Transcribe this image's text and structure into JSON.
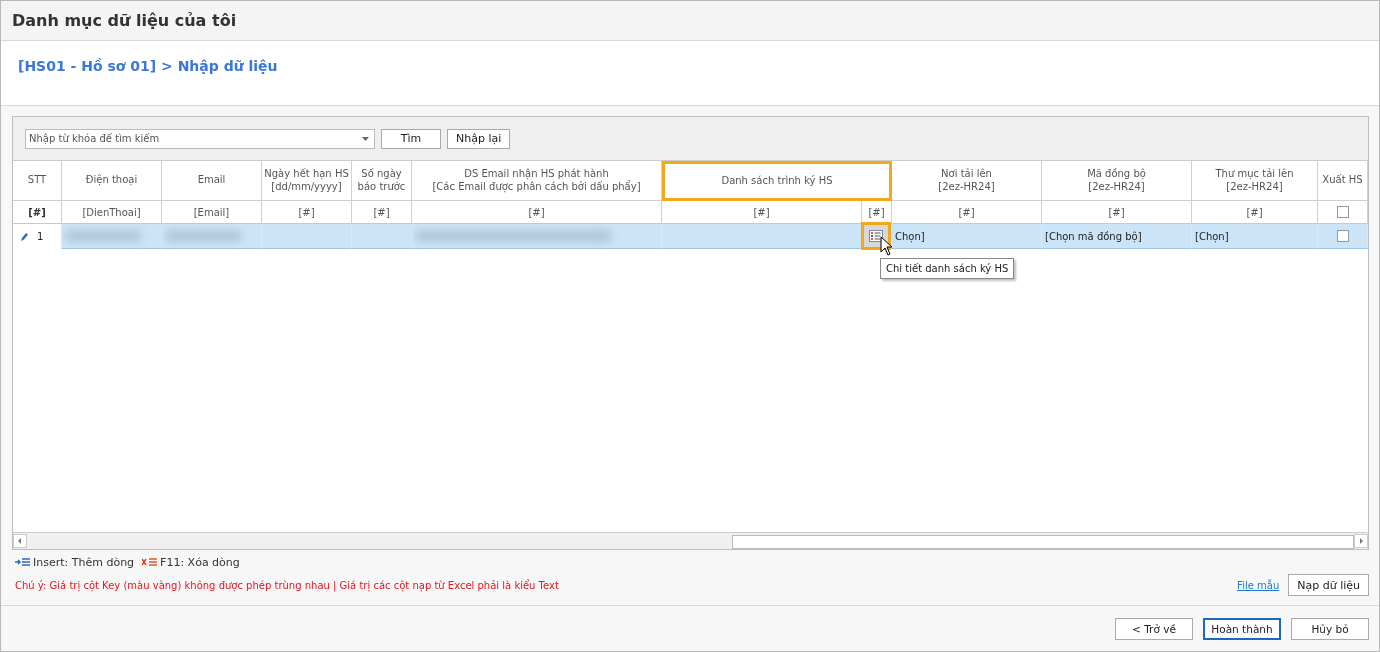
{
  "window": {
    "title": "Danh mục dữ liệu của tôi"
  },
  "breadcrumb": "[HS01 - Hồ sơ 01] > Nhập dữ liệu",
  "search": {
    "placeholder": "Nhập từ khóa để tìm kiếm"
  },
  "toolbar_buttons": [
    "Tìm",
    "Nhập lại"
  ],
  "columns": [
    {
      "header": "STT",
      "filters": [
        {
          "kind": "text",
          "text": "[#]"
        }
      ],
      "highlighted": false
    },
    {
      "header": "Điện thoại",
      "filters": [
        {
          "kind": "text",
          "text": "[DienThoai]"
        }
      ],
      "highlighted": false
    },
    {
      "header": "Email",
      "filters": [
        {
          "kind": "text",
          "text": "[Email]"
        }
      ],
      "highlighted": false
    },
    {
      "header": "Ngày hết hạn HS\n[dd/mm/yyyy]",
      "filters": [
        {
          "kind": "text",
          "text": "[#]"
        }
      ],
      "highlighted": false
    },
    {
      "header": "Số ngày\nbáo trước",
      "filters": [
        {
          "kind": "text",
          "text": "[#]"
        }
      ],
      "highlighted": false
    },
    {
      "header": "DS Email nhận HS phát hành\n[Các Email được phân cách bởi dấu phẩy]",
      "filters": [
        {
          "kind": "text",
          "text": "[#]"
        }
      ],
      "highlighted": false
    },
    {
      "header": "Danh sách trình ký HS",
      "filters": [
        {
          "kind": "text",
          "text": "[#]"
        },
        {
          "kind": "text",
          "text": "[#]"
        }
      ],
      "highlighted": true
    },
    {
      "header": "Nơi tải lên\n[2ez-HR24]",
      "filters": [
        {
          "kind": "text",
          "text": "[#]"
        }
      ],
      "highlighted": false
    },
    {
      "header": "Mã đồng bộ\n[2ez-HR24]",
      "filters": [
        {
          "kind": "text",
          "text": "[#]"
        }
      ],
      "highlighted": false
    },
    {
      "header": "Thư mục tải lên\n[2ez-HR24]",
      "filters": [
        {
          "kind": "text",
          "text": "[#]"
        }
      ],
      "highlighted": false
    },
    {
      "header": "Xuất HS",
      "filters": [
        {
          "kind": "checkbox",
          "checked": false
        }
      ],
      "highlighted": false
    }
  ],
  "rows": [
    {
      "selected": true,
      "editing": true,
      "number": "1",
      "cells": [
        {
          "kind": "blurred"
        },
        {
          "kind": "blurred"
        },
        {
          "kind": "empty"
        },
        {
          "kind": "empty"
        },
        {
          "kind": "blurred"
        },
        {
          "kind": "empty"
        },
        {
          "kind": "list-button",
          "highlighted": true
        },
        {
          "kind": "text",
          "text": "Chọn]"
        },
        {
          "kind": "text",
          "text": "[Chọn mã đồng bộ]"
        },
        {
          "kind": "text",
          "text": "[Chọn]"
        },
        {
          "kind": "checkbox",
          "checked": false
        }
      ]
    }
  ],
  "tooltip": "Chi tiết danh sách ký HS",
  "shortcuts": [
    {
      "kind": "insert",
      "text": "Insert: Thêm dòng"
    },
    {
      "kind": "delete",
      "text": "F11: Xóa dòng"
    }
  ],
  "note": "Chú ý: Giá trị cột Key (màu vàng) không được phép trùng nhau | Giá trị các cột nạp từ Excel phải là kiểu Text",
  "template_link": "File mẫu",
  "import_button": "Nạp dữ liệu",
  "footer_buttons": [
    {
      "label": "< Trở về",
      "focused": false
    },
    {
      "label": "Hoàn thành",
      "focused": true
    },
    {
      "label": "Hủy bỏ",
      "focused": false
    }
  ]
}
